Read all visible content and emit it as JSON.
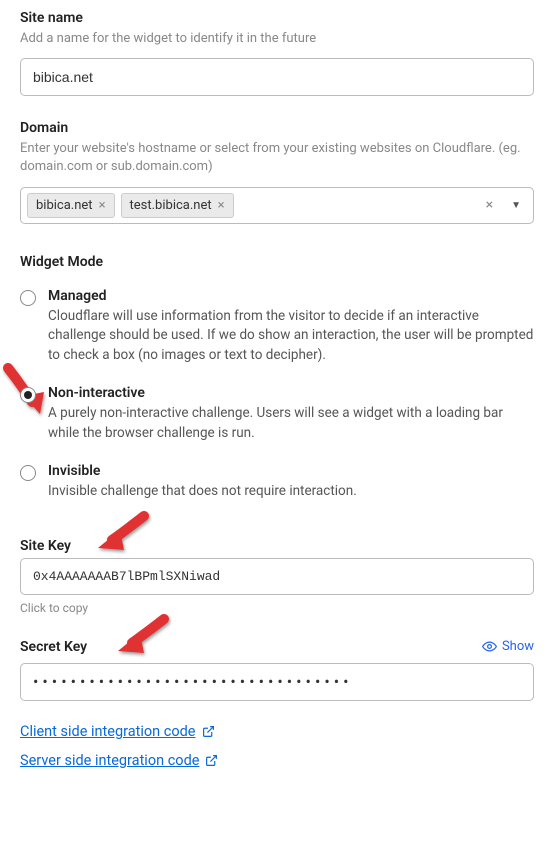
{
  "siteName": {
    "label": "Site name",
    "hint": "Add a name for the widget to identify it in the future",
    "value": "bibica.net"
  },
  "domain": {
    "label": "Domain",
    "hint": "Enter your website's hostname or select from your existing websites on Cloudflare. (eg. domain.com or sub.domain.com)",
    "tags": [
      "bibica.net",
      "test.bibica.net"
    ]
  },
  "widgetMode": {
    "heading": "Widget Mode",
    "options": [
      {
        "label": "Managed",
        "desc": "Cloudflare will use information from the visitor to decide if an interactive challenge should be used. If we do show an interaction, the user will be prompted to check a box (no images or text to decipher).",
        "checked": false
      },
      {
        "label": "Non-interactive",
        "desc": "A purely non-interactive challenge. Users will see a widget with a loading bar while the browser challenge is run.",
        "checked": true
      },
      {
        "label": "Invisible",
        "desc": "Invisible challenge that does not require interaction.",
        "checked": false
      }
    ]
  },
  "siteKey": {
    "label": "Site Key",
    "value": "0x4AAAAAAAB7lBPmlSXNiwad",
    "copyHint": "Click to copy"
  },
  "secretKey": {
    "label": "Secret Key",
    "show": "Show",
    "masked": "••••••••••••••••••••••••••••••••••"
  },
  "links": {
    "client": "Client side integration code",
    "server": "Server side integration code"
  }
}
